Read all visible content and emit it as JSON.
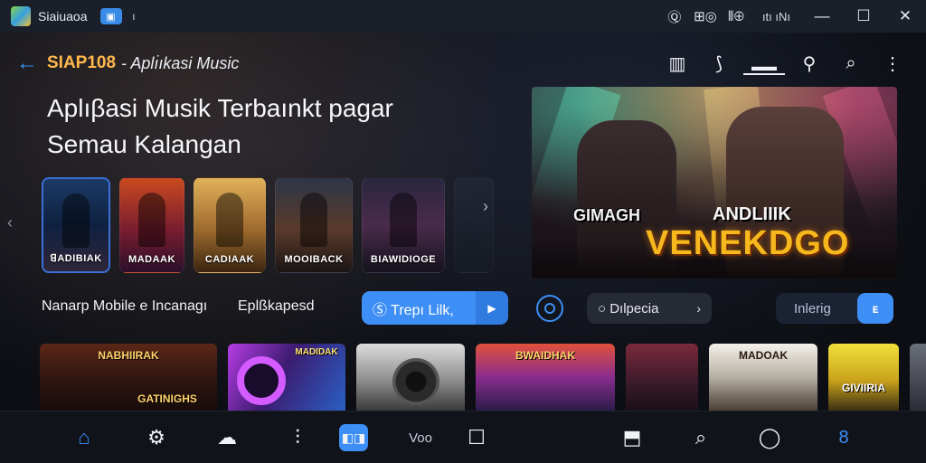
{
  "titlebar": {
    "app_name": "Siaiuaoa",
    "chip_icon": "gamepad-icon",
    "small_text": "ι",
    "right_icons": [
      {
        "name": "help-icon",
        "glyph": "Ⓠ"
      },
      {
        "name": "keyboard-icon",
        "glyph": "⊞◎"
      },
      {
        "name": "record-icon",
        "glyph": "⦀⊕"
      }
    ],
    "right_text": "ıtı ıNı",
    "minimize": "—",
    "maximize": "☐",
    "close": "✕"
  },
  "topbar": {
    "back": "←",
    "brand": "SIAP108",
    "subtitle": "- Aplı̇ıkasi Music",
    "icons": [
      {
        "name": "library-icon",
        "glyph": "▥"
      },
      {
        "name": "tools-icon",
        "glyph": "⟆"
      },
      {
        "name": "menu-lines-icon",
        "glyph": "▬▬"
      },
      {
        "name": "location-icon",
        "glyph": "⚲"
      },
      {
        "name": "search-icon",
        "glyph": "⌕"
      },
      {
        "name": "more-icon",
        "glyph": "⋮"
      }
    ]
  },
  "headline": {
    "line1": "Aplıβasi Musik Terbaınkt pagar",
    "line2": "Semau Kalangan"
  },
  "covers": [
    {
      "caption": "ꓭADIBIAK"
    },
    {
      "caption": "MADAAK"
    },
    {
      "caption": "CADIAAK"
    },
    {
      "caption": "MOOIBACK"
    },
    {
      "caption": "BIAWIDIOGE"
    },
    {
      "caption": ""
    }
  ],
  "carousel": {
    "prev": "‹",
    "next": "›"
  },
  "hero": {
    "text1": "GIMAGH",
    "text2": "ANDLIIIK",
    "text3": "VENEKDGO"
  },
  "controls": {
    "label1": "Nanarp Mobile e Incanagı",
    "label2": "Eplßkapesd",
    "blue_pill": {
      "label": "Ⓢ Trepı Lilk,",
      "arrow": "▶"
    },
    "dark_pill": {
      "label": "○ Dılpecia",
      "arrow": "›"
    },
    "right_pill": {
      "label": "Inlerig",
      "button": "ᴇ"
    }
  },
  "tiles": [
    {
      "caption": "NABHIIRAK",
      "caption2": "GATINIGHS"
    },
    {
      "caption": "MADIDAK"
    },
    {
      "caption": ""
    },
    {
      "caption": "BWAIDHAK"
    },
    {
      "caption": ""
    },
    {
      "caption": "MADOAK"
    },
    {
      "caption": "GIVIIRIA"
    },
    {
      "caption": ""
    }
  ],
  "bottombar": {
    "items": [
      {
        "name": "home-icon",
        "glyph": "⌂"
      },
      {
        "name": "settings-icon",
        "glyph": "⚙"
      },
      {
        "name": "cloud-icon",
        "glyph": "☁"
      },
      {
        "name": "microphone-icon",
        "glyph": "⫶"
      },
      {
        "name": "screens-icon",
        "glyph": "◧◨"
      },
      {
        "name": "vod-label",
        "glyph": "Voo"
      },
      {
        "name": "window-icon",
        "glyph": "☐"
      },
      {
        "name": "share-icon",
        "glyph": "⬒"
      },
      {
        "name": "search-icon",
        "glyph": "⌕"
      },
      {
        "name": "circle-icon",
        "glyph": "◯"
      },
      {
        "name": "link-icon",
        "glyph": "8"
      }
    ]
  }
}
